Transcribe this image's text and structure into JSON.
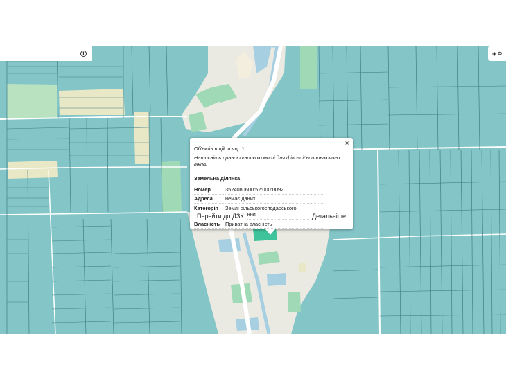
{
  "popup": {
    "count_text": "Об'єктів в цій точці: 1",
    "hint_text": "Натисніть правою кнопкою миші для фіксації вспливаючого вікна.",
    "section_title": "Земельна ділянка",
    "rows": [
      {
        "key": "Номер",
        "value": "3524080600:52:000:0092"
      },
      {
        "key": "Адреса",
        "value": "немає даних"
      },
      {
        "key": "Категорія",
        "value": "Землі сільськогосподарського призначення"
      },
      {
        "key": "Власність",
        "value": "Приватна власність"
      }
    ],
    "goto_label": "Перейти до ДЗК",
    "details_label": "Детальніше",
    "close_glyph": "×"
  },
  "toolbar": {
    "info_glyph": "i",
    "layers_icon": "layers-icon",
    "layers_label": "Ф"
  },
  "colors": {
    "parcel": "#84c6c8",
    "parcel_line": "#3d7f85",
    "village": "#ebeae2",
    "road": "#ffffff",
    "water": "#a7cfe2",
    "meadow": "#b8e2c0",
    "highlight": "#3fc39b",
    "field": "#e9e8c6"
  }
}
